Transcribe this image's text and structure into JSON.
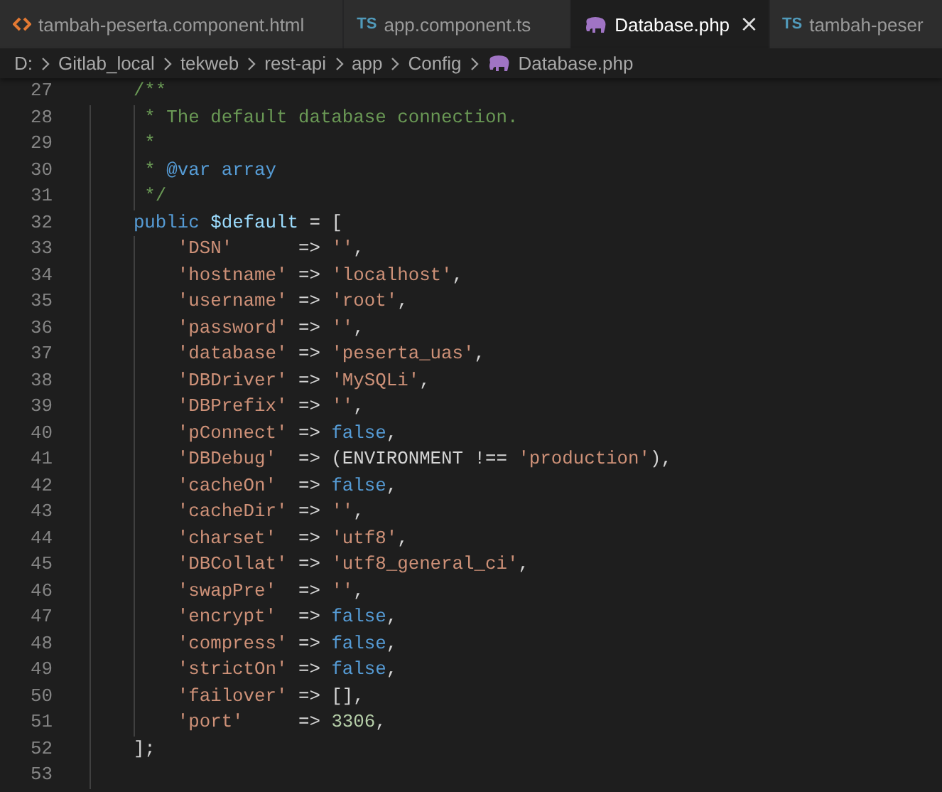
{
  "tabs": [
    {
      "label": "tambah-peserta.component.html",
      "kind": "html",
      "selected": false
    },
    {
      "label": "app.component.ts",
      "kind": "ts",
      "icon_text": "TS",
      "selected": false
    },
    {
      "label": "Database.php",
      "kind": "php",
      "selected": true,
      "close": "×"
    },
    {
      "label": "tambah-peser",
      "kind": "ts",
      "icon_text": "TS",
      "selected": false
    }
  ],
  "breadcrumb": [
    {
      "label": "D:",
      "kind": "folder"
    },
    {
      "label": "Gitlab_local",
      "kind": "folder"
    },
    {
      "label": "tekweb",
      "kind": "folder"
    },
    {
      "label": "rest-api",
      "kind": "folder"
    },
    {
      "label": "app",
      "kind": "folder"
    },
    {
      "label": "Config",
      "kind": "folder"
    },
    {
      "label": "Database.php",
      "kind": "php"
    }
  ],
  "editor": {
    "lines": [
      {
        "number": "27",
        "kind": "code",
        "tokens": [
          {
            "kind": "comment",
            "text": "/**"
          }
        ]
      },
      {
        "number": "28",
        "kind": "doc",
        "tokens": [
          {
            "kind": "comment",
            "text": "* The default database connection."
          }
        ]
      },
      {
        "number": "29",
        "kind": "doc",
        "tokens": [
          {
            "kind": "comment",
            "text": "*"
          }
        ]
      },
      {
        "number": "30",
        "kind": "doc",
        "tokens": [
          {
            "kind": "comment",
            "text": "* "
          },
          {
            "kind": "doc",
            "text": "@var array"
          }
        ]
      },
      {
        "number": "31",
        "kind": "doc",
        "tokens": [
          {
            "kind": "comment",
            "text": "*/"
          }
        ]
      },
      {
        "number": "32",
        "kind": "code",
        "tokens": [
          {
            "kind": "keyword",
            "text": "public "
          },
          {
            "kind": "variable",
            "text": "$default"
          },
          {
            "kind": "plain",
            "text": " = ["
          }
        ],
        "children": [
          {
            "number": "33",
            "kind": "code",
            "tokens": [
              {
                "kind": "string",
                "text": "'DSN'"
              },
              {
                "kind": "plain",
                "text": "      => "
              },
              {
                "kind": "string",
                "text": "''"
              },
              {
                "kind": "plain",
                "text": ","
              }
            ]
          },
          {
            "number": "34",
            "kind": "code",
            "tokens": [
              {
                "kind": "string",
                "text": "'hostname'"
              },
              {
                "kind": "plain",
                "text": " => "
              },
              {
                "kind": "string",
                "text": "'localhost'"
              },
              {
                "kind": "plain",
                "text": ","
              }
            ]
          },
          {
            "number": "35",
            "kind": "code",
            "tokens": [
              {
                "kind": "string",
                "text": "'username'"
              },
              {
                "kind": "plain",
                "text": " => "
              },
              {
                "kind": "string",
                "text": "'root'"
              },
              {
                "kind": "plain",
                "text": ","
              }
            ]
          },
          {
            "number": "36",
            "kind": "code",
            "tokens": [
              {
                "kind": "string",
                "text": "'password'"
              },
              {
                "kind": "plain",
                "text": " => "
              },
              {
                "kind": "string",
                "text": "''"
              },
              {
                "kind": "plain",
                "text": ","
              }
            ]
          },
          {
            "number": "37",
            "kind": "code",
            "tokens": [
              {
                "kind": "string",
                "text": "'database'"
              },
              {
                "kind": "plain",
                "text": " => "
              },
              {
                "kind": "string",
                "text": "'peserta_uas'"
              },
              {
                "kind": "plain",
                "text": ","
              }
            ]
          },
          {
            "number": "38",
            "kind": "code",
            "tokens": [
              {
                "kind": "string",
                "text": "'DBDriver'"
              },
              {
                "kind": "plain",
                "text": " => "
              },
              {
                "kind": "string",
                "text": "'MySQLi'"
              },
              {
                "kind": "plain",
                "text": ","
              }
            ]
          },
          {
            "number": "39",
            "kind": "code",
            "tokens": [
              {
                "kind": "string",
                "text": "'DBPrefix'"
              },
              {
                "kind": "plain",
                "text": " => "
              },
              {
                "kind": "string",
                "text": "''"
              },
              {
                "kind": "plain",
                "text": ","
              }
            ]
          },
          {
            "number": "40",
            "kind": "code",
            "tokens": [
              {
                "kind": "string",
                "text": "'pConnect'"
              },
              {
                "kind": "plain",
                "text": " => "
              },
              {
                "kind": "keyword",
                "text": "false"
              },
              {
                "kind": "plain",
                "text": ","
              }
            ]
          },
          {
            "number": "41",
            "kind": "code",
            "tokens": [
              {
                "kind": "string",
                "text": "'DBDebug'"
              },
              {
                "kind": "plain",
                "text": "  => (ENVIRONMENT !== "
              },
              {
                "kind": "string",
                "text": "'production'"
              },
              {
                "kind": "plain",
                "text": "),"
              }
            ]
          },
          {
            "number": "42",
            "kind": "code",
            "tokens": [
              {
                "kind": "string",
                "text": "'cacheOn'"
              },
              {
                "kind": "plain",
                "text": "  => "
              },
              {
                "kind": "keyword",
                "text": "false"
              },
              {
                "kind": "plain",
                "text": ","
              }
            ]
          },
          {
            "number": "43",
            "kind": "code",
            "tokens": [
              {
                "kind": "string",
                "text": "'cacheDir'"
              },
              {
                "kind": "plain",
                "text": " => "
              },
              {
                "kind": "string",
                "text": "''"
              },
              {
                "kind": "plain",
                "text": ","
              }
            ]
          },
          {
            "number": "44",
            "kind": "code",
            "tokens": [
              {
                "kind": "string",
                "text": "'charset'"
              },
              {
                "kind": "plain",
                "text": "  => "
              },
              {
                "kind": "string",
                "text": "'utf8'"
              },
              {
                "kind": "plain",
                "text": ","
              }
            ]
          },
          {
            "number": "45",
            "kind": "code",
            "tokens": [
              {
                "kind": "string",
                "text": "'DBCollat'"
              },
              {
                "kind": "plain",
                "text": " => "
              },
              {
                "kind": "string",
                "text": "'utf8_general_ci'"
              },
              {
                "kind": "plain",
                "text": ","
              }
            ]
          },
          {
            "number": "46",
            "kind": "code",
            "tokens": [
              {
                "kind": "string",
                "text": "'swapPre'"
              },
              {
                "kind": "plain",
                "text": "  => "
              },
              {
                "kind": "string",
                "text": "''"
              },
              {
                "kind": "plain",
                "text": ","
              }
            ]
          },
          {
            "number": "47",
            "kind": "code",
            "tokens": [
              {
                "kind": "string",
                "text": "'encrypt'"
              },
              {
                "kind": "plain",
                "text": "  => "
              },
              {
                "kind": "keyword",
                "text": "false"
              },
              {
                "kind": "plain",
                "text": ","
              }
            ]
          },
          {
            "number": "48",
            "kind": "code",
            "tokens": [
              {
                "kind": "string",
                "text": "'compress'"
              },
              {
                "kind": "plain",
                "text": " => "
              },
              {
                "kind": "keyword",
                "text": "false"
              },
              {
                "kind": "plain",
                "text": ","
              }
            ]
          },
          {
            "number": "49",
            "kind": "code",
            "tokens": [
              {
                "kind": "string",
                "text": "'strictOn'"
              },
              {
                "kind": "plain",
                "text": " => "
              },
              {
                "kind": "keyword",
                "text": "false"
              },
              {
                "kind": "plain",
                "text": ","
              }
            ]
          },
          {
            "number": "50",
            "kind": "code",
            "tokens": [
              {
                "kind": "string",
                "text": "'failover'"
              },
              {
                "kind": "plain",
                "text": " => [],"
              }
            ]
          },
          {
            "number": "51",
            "kind": "code",
            "tokens": [
              {
                "kind": "string",
                "text": "'port'"
              },
              {
                "kind": "plain",
                "text": "     => "
              },
              {
                "kind": "number",
                "text": "3306"
              },
              {
                "kind": "plain",
                "text": ","
              }
            ]
          }
        ]
      },
      {
        "number": "52",
        "kind": "code",
        "tokens": [
          {
            "kind": "plain",
            "text": "];"
          }
        ]
      },
      {
        "number": "53",
        "kind": "blank"
      }
    ]
  }
}
